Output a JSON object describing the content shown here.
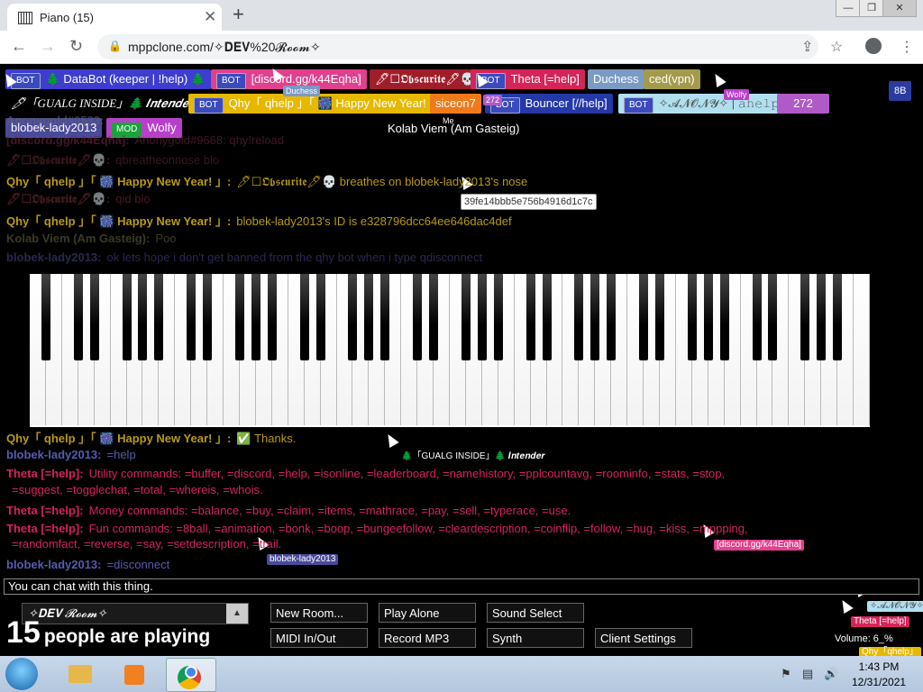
{
  "browser": {
    "tab_title": "Piano (15)",
    "tab_close": "✕",
    "new_tab": "+",
    "url": "mppclone.com/✧𝐃𝐄𝐕%20𝓡𝓸𝓸𝓶✧",
    "window_controls": {
      "minimize": "—",
      "maximize": "❐",
      "close": "✕"
    }
  },
  "users": [
    {
      "bot": "BOT",
      "name": "🌲 DataBot (keeper | !help) 🌲",
      "color": "#3d3dcf"
    },
    {
      "bot": "BOT",
      "name": "[discord.gg/k44Eqha]",
      "color": "#e0408e"
    },
    {
      "name": "🖊☐𝕺𝖇𝖘𝖈𝖚𝖗𝖎𝖙𝖊🖊💀",
      "color": "#a01e2a"
    },
    {
      "bot": "BOT",
      "name": "Theta [=help]",
      "color": "#d5245a"
    },
    {
      "name": "Duchess",
      "color": "#7b9ac4"
    },
    {
      "name": "ced(vpn)",
      "color": "#a39a4c"
    },
    {
      "name": "🖊「GUALG INSIDE」🌲 𝑰𝒏𝒕𝒆𝒏𝒅𝒆𝒓",
      "color": "#000000"
    },
    {
      "bot": "BOT",
      "name": "Qhy「 qhelp 」「 🎆 Happy New Year! 」",
      "color": "#e6b800"
    },
    {
      "name": "siceon7",
      "color": "#f07a1a"
    },
    {
      "bot": "BOT",
      "name": "Bouncer [//help]",
      "color": "#2438a8"
    },
    {
      "bot": "BOT",
      "name": "✧𝓐𝓝𝓞𝓝𝓨✧ | 𝚊𝚑𝚎𝚕𝚙 |",
      "color": "#b0e0f0"
    },
    {
      "name": "272",
      "color": "#b05ac7"
    },
    {
      "name": "blobek-lady2013",
      "color": "#4a4a9a"
    },
    {
      "mod": "MOD",
      "name": "Wolfy",
      "color": "#b840c9"
    }
  ],
  "room_badge": "8B",
  "me_label": "Me",
  "me_name": "Kolab Viem (Am Gasteig)",
  "floating_labels": {
    "duchess": "Duchess",
    "n272": "272",
    "wolfy": "Wolfy",
    "tooltip_id": "39fe14bbb5e756b4916d1c7c",
    "gualg": "🌲「GUALG INSIDE」🌲 𝑰𝒏𝒕𝒆𝒏𝒅𝒆𝒓",
    "discord": "[discord.gg/k44Eqha]",
    "blobek": "blobek-lady2013",
    "anony_right": "✧𝓐𝓝𝓞𝓝𝓨✧",
    "theta_right": "Theta [=help]",
    "qhy_right": "Qhy「qhelp」"
  },
  "chat": [
    {
      "who": "Anonygold#0533:",
      "text": "",
      "color": "#666666",
      "faded": true
    },
    {
      "who": "[discord.gg/k44Eqha]:",
      "text": "Anonygold#9668: qhy!reload",
      "color": "#7a2848",
      "faded": true
    },
    {
      "who": "🖊☐𝕺𝖇𝖘𝖈𝖚𝖗𝖎𝖙𝖊🖊💀:",
      "text": "qbreatheonnose blo",
      "color": "#6a2a30",
      "faded": true
    },
    {
      "who": "Qhy「 qhelp 」「 🎆 Happy New Year! 」:",
      "text": "🖊☐𝕺𝖇𝖘𝖈𝖚𝖗𝖎𝖙𝖊🖊💀 breathes on blobek-lady2013's nose",
      "color": "#b89a1a"
    },
    {
      "who": "🖊☐𝕺𝖇𝖘𝖈𝖚𝖗𝖎𝖙𝖊🖊💀:",
      "text": "qid blo",
      "color": "#7a3038",
      "faded": true
    },
    {
      "who": "Qhy「 qhelp 」「 🎆 Happy New Year! 」:",
      "text": "blobek-lady2013's ID is e328796dcc64ee646dac4def",
      "color": "#b89a1a"
    },
    {
      "who": "Kolab Viem (Am Gasteig):",
      "text": "Poo",
      "color": "#6a6a4a",
      "faded": true
    },
    {
      "who": "blobek-lady2013:",
      "text": "ok lets hope i don't get banned from the qhy bot when i type qdisconnect",
      "color": "#4a4a90",
      "faded": true
    },
    {
      "who": "Qhy「 qhelp 」「 🎆 Happy New Year! 」:",
      "text": "✅ Thanks.",
      "color": "#b89a1a"
    },
    {
      "who": "blobek-lady2013:",
      "text": "=help",
      "color": "#5a5ab0"
    },
    {
      "who": "Theta [=help]:",
      "text": "Utility commands: =buffer, =discord, =help, =isonline, =leaderboard, =namehistory, =pplcountavg, =roominfo, =stats, =stop,",
      "color": "#d5245a"
    },
    {
      "who": "",
      "text": "=suggest, =togglechat, =total, =whereis, =whois.",
      "color": "#d5245a"
    },
    {
      "who": "Theta [=help]:",
      "text": "Money commands: =balance, =buy, =claim, =items, =mathrace, =pay, =sell, =typerace, =use.",
      "color": "#d5245a"
    },
    {
      "who": "Theta [=help]:",
      "text": "Fun commands: =8ball, =animation, =bonk, =boop, =bungeefollow, =cleardescription, =coinflip, =follow, =hug, =kiss, =mppping,",
      "color": "#d5245a"
    },
    {
      "who": "",
      "text": "=randomfact, =reverse, =say, =setdescription, =trail.",
      "color": "#d5245a"
    },
    {
      "who": "blobek-lady2013:",
      "text": "=disconnect",
      "color": "#5a5ab0"
    }
  ],
  "chat_input_placeholder": "You can chat with this thing.",
  "room_name": "✧𝐃𝐄𝐕 𝓡𝓸𝓸𝓶✧",
  "room_arrow": "▲",
  "people_count": "15",
  "people_text": "people are playing",
  "buttons": {
    "new_room": "New Room...",
    "play_alone": "Play Alone",
    "sound_select": "Sound Select",
    "midi": "MIDI In/Out",
    "record": "Record MP3",
    "synth": "Synth",
    "client_settings": "Client Settings"
  },
  "volume_text": "Volume: 6_%",
  "taskbar": {
    "time": "1:43 PM",
    "date": "12/31/2021"
  }
}
